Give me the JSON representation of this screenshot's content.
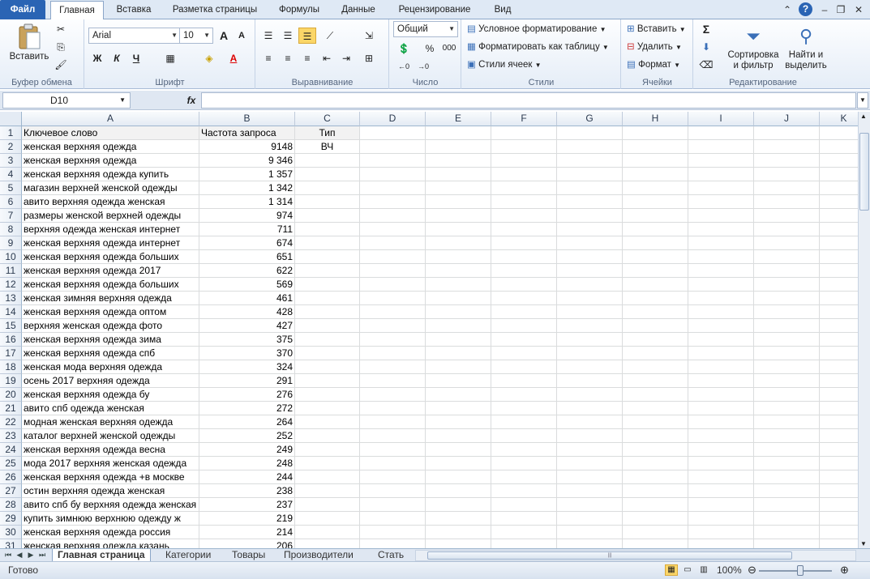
{
  "ribbon_tabs": [
    {
      "label": "Файл"
    },
    {
      "label": "Главная"
    },
    {
      "label": "Вставка"
    },
    {
      "label": "Разметка страницы"
    },
    {
      "label": "Формулы"
    },
    {
      "label": "Данные"
    },
    {
      "label": "Рецензирование"
    },
    {
      "label": "Вид"
    }
  ],
  "clipboard": {
    "paste": "Вставить",
    "group": "Буфер обмена"
  },
  "font": {
    "name": "Arial",
    "size": "10",
    "bold": "Ж",
    "italic": "К",
    "underline": "Ч",
    "grow": "A",
    "shrink": "A",
    "group": "Шрифт"
  },
  "alignment": {
    "group": "Выравнивание"
  },
  "number": {
    "format": "Общий",
    "percent": "%",
    "thousands": "000",
    "group": "Число"
  },
  "styles": {
    "conditional": "Условное форматирование",
    "table": "Форматировать как таблицу",
    "cell": "Стили ячеек",
    "group": "Стили"
  },
  "cells": {
    "insert": "Вставить",
    "delete": "Удалить",
    "format": "Формат",
    "group": "Ячейки"
  },
  "editing": {
    "sigma": "Σ",
    "sort1": "Сортировка",
    "sort2": "и фильтр",
    "find1": "Найти и",
    "find2": "выделить",
    "group": "Редактирование"
  },
  "formula_bar": {
    "name_box": "D10",
    "fx": "fx",
    "value": ""
  },
  "columns": [
    "A",
    "B",
    "C",
    "D",
    "E",
    "F",
    "G",
    "H",
    "I",
    "J",
    "K"
  ],
  "rows": [
    {
      "n": "1",
      "a": "Ключевое слово",
      "b": "Частота запроса",
      "c": "Тип"
    },
    {
      "n": "2",
      "a": "женская верхняя одежда",
      "b": "9148",
      "c": "ВЧ"
    },
    {
      "n": "3",
      "a": "женская верхняя одежда",
      "b": "9 346",
      "c": ""
    },
    {
      "n": "4",
      "a": "женская верхняя одежда купить",
      "b": "1 357",
      "c": ""
    },
    {
      "n": "5",
      "a": "магазин верхней женской одежды",
      "b": "1 342",
      "c": ""
    },
    {
      "n": "6",
      "a": "авито верхняя одежда женская",
      "b": "1 314",
      "c": ""
    },
    {
      "n": "7",
      "a": "размеры женской верхней одежды",
      "b": "974",
      "c": ""
    },
    {
      "n": "8",
      "a": "верхняя одежда женская интернет",
      "b": "711",
      "c": ""
    },
    {
      "n": "9",
      "a": "женская верхняя одежда интернет",
      "b": "674",
      "c": ""
    },
    {
      "n": "10",
      "a": "женская верхняя одежда больших",
      "b": "651",
      "c": ""
    },
    {
      "n": "11",
      "a": "женская верхняя одежда 2017",
      "b": "622",
      "c": ""
    },
    {
      "n": "12",
      "a": "женская верхняя одежда больших",
      "b": "569",
      "c": ""
    },
    {
      "n": "13",
      "a": "женская зимняя верхняя одежда",
      "b": "461",
      "c": ""
    },
    {
      "n": "14",
      "a": "женская верхняя одежда оптом",
      "b": "428",
      "c": ""
    },
    {
      "n": "15",
      "a": "верхняя женская одежда фото",
      "b": "427",
      "c": ""
    },
    {
      "n": "16",
      "a": "женская верхняя одежда зима",
      "b": "375",
      "c": ""
    },
    {
      "n": "17",
      "a": "женская верхняя одежда спб",
      "b": "370",
      "c": ""
    },
    {
      "n": "18",
      "a": "женская мода верхняя одежда",
      "b": "324",
      "c": ""
    },
    {
      "n": "19",
      "a": "осень 2017 верхняя одежда",
      "b": "291",
      "c": ""
    },
    {
      "n": "20",
      "a": "женская верхняя одежда бу",
      "b": "276",
      "c": ""
    },
    {
      "n": "21",
      "a": "авито спб одежда женская",
      "b": "272",
      "c": ""
    },
    {
      "n": "22",
      "a": "модная женская верхняя одежда",
      "b": "264",
      "c": ""
    },
    {
      "n": "23",
      "a": "каталог верхней женской одежды",
      "b": "252",
      "c": ""
    },
    {
      "n": "24",
      "a": "женская верхняя одежда весна",
      "b": "249",
      "c": ""
    },
    {
      "n": "25",
      "a": "мода 2017 верхняя женская одежда",
      "b": "248",
      "c": ""
    },
    {
      "n": "26",
      "a": "женская верхняя одежда +в москве",
      "b": "244",
      "c": ""
    },
    {
      "n": "27",
      "a": "остин верхняя одежда женская",
      "b": "238",
      "c": ""
    },
    {
      "n": "28",
      "a": "авито спб бу верхняя одежда женская",
      "b": "237",
      "c": ""
    },
    {
      "n": "29",
      "a": "купить зимнюю верхнюю одежду ж",
      "b": "219",
      "c": ""
    },
    {
      "n": "30",
      "a": "женская верхняя одежда россия",
      "b": "214",
      "c": ""
    },
    {
      "n": "31",
      "a": "женская верхняя одежда казань",
      "b": "206",
      "c": ""
    }
  ],
  "sheet_tabs": [
    "Главная страница",
    "Категории",
    "Товары",
    "Производители",
    "Стать"
  ],
  "status": {
    "ready": "Готово",
    "zoom": "100%"
  }
}
